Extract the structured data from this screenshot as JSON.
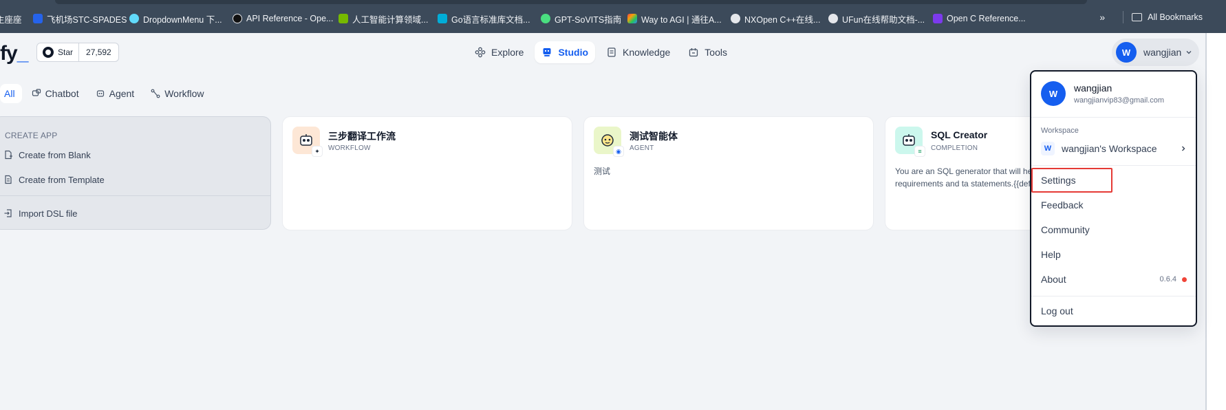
{
  "browser": {
    "bookmarks": [
      {
        "label": "主座座",
        "icon": "none",
        "color": "#3c4a5a"
      },
      {
        "label": "飞机场STC-SPADES",
        "icon": "plane-icon",
        "color": "#3b82f6"
      },
      {
        "label": "DropdownMenu 下...",
        "icon": "react-icon",
        "color": "#61dafb"
      },
      {
        "label": "API Reference - Ope...",
        "icon": "openai-icon",
        "color": "#e5e7eb"
      },
      {
        "label": "人工智能计算领域...",
        "icon": "nvidia-icon",
        "color": "#76b900"
      },
      {
        "label": "Go语言标准库文档...",
        "icon": "go-icon",
        "color": "#00add8"
      },
      {
        "label": "GPT-SoVITS指南",
        "icon": "leaf-icon",
        "color": "#4ade80"
      },
      {
        "label": "Way to AGI | 通往A...",
        "icon": "rainbow-icon",
        "color": "#f59e0b"
      },
      {
        "label": "NXOpen C++在线...",
        "icon": "globe-icon",
        "color": "#e5e7eb"
      },
      {
        "label": "UFun在线帮助文档-...",
        "icon": "globe-icon",
        "color": "#e5e7eb"
      },
      {
        "label": "Open C Reference...",
        "icon": "doc-icon",
        "color": "#7c3aed"
      }
    ],
    "overflow": "»",
    "all_bookmarks": "All Bookmarks"
  },
  "header": {
    "logo_text": "fy",
    "logo_dot": "_",
    "star_label": "Star",
    "star_count": "27,592",
    "nav": [
      {
        "label": "Explore",
        "icon": "explore-icon",
        "active": false
      },
      {
        "label": "Studio",
        "icon": "studio-icon",
        "active": true
      },
      {
        "label": "Knowledge",
        "icon": "knowledge-icon",
        "active": false
      },
      {
        "label": "Tools",
        "icon": "tools-icon",
        "active": false
      }
    ],
    "user": {
      "initial": "W",
      "name": "wangjian"
    }
  },
  "tabs": [
    {
      "label": "All",
      "icon": "",
      "active": true
    },
    {
      "label": "Chatbot",
      "icon": "chatbot-icon",
      "active": false
    },
    {
      "label": "Agent",
      "icon": "agent-icon",
      "active": false
    },
    {
      "label": "Workflow",
      "icon": "workflow-icon",
      "active": false
    }
  ],
  "create": {
    "title": "CREATE APP",
    "blank": "Create from Blank",
    "template": "Create from Template",
    "import": "Import DSL file"
  },
  "apps": [
    {
      "name": "三步翻译工作流",
      "type": "WORKFLOW",
      "desc": "",
      "icon": "robot-icon",
      "bg": "#fde7d6",
      "badge": "workflow-badge-icon"
    },
    {
      "name": "测试智能体",
      "type": "AGENT",
      "desc": "测试",
      "icon": "face-icon",
      "bg": "#eaf6c9",
      "badge": "agent-badge-icon"
    },
    {
      "name": "SQL Creator",
      "type": "COMPLETION",
      "desc": "You are an SQL generator that will he language query requirements and ta statements.{{default_input}}",
      "icon": "robot-icon",
      "bg": "#ccf7ed",
      "badge": "completion-badge-icon"
    }
  ],
  "dropdown": {
    "initial": "W",
    "name": "wangjian",
    "email": "wangjianvip83@gmail.com",
    "workspace_label": "Workspace",
    "workspace_initial": "W",
    "workspace_name": "wangjian's Workspace",
    "items": {
      "settings": "Settings",
      "feedback": "Feedback",
      "community": "Community",
      "help": "Help",
      "about": "About",
      "version": "0.6.4",
      "logout": "Log out"
    }
  },
  "colors": {
    "accent": "#155eef",
    "highlight": "#e53935",
    "update_dot": "#f04438"
  }
}
